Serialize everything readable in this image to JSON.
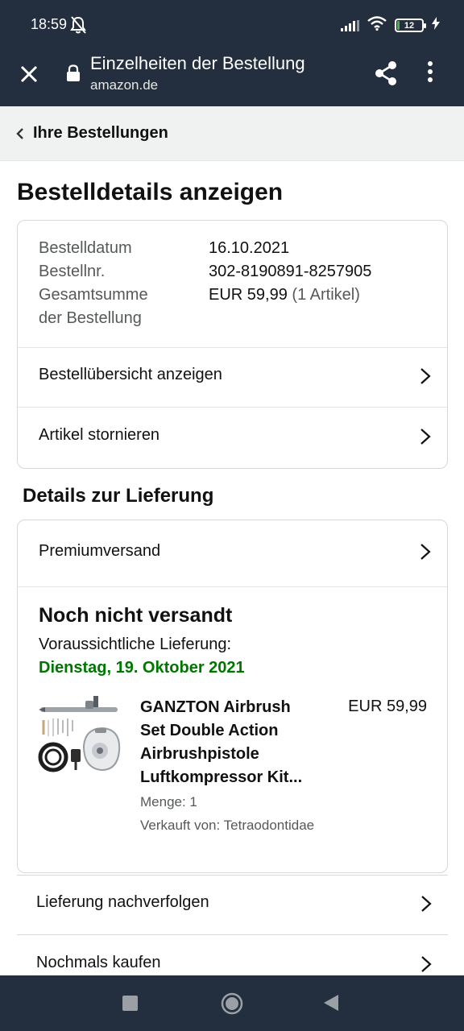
{
  "status_bar": {
    "time": "18:59",
    "battery": "12",
    "icons": [
      "mute-bell-icon",
      "signal-icon",
      "wifi-icon",
      "battery-icon",
      "charging-bolt-icon"
    ]
  },
  "browser": {
    "title": "Einzelheiten der Bestellung",
    "domain": "amazon.de",
    "icons": [
      "close-icon",
      "lock-icon",
      "share-icon",
      "more-vertical-icon"
    ]
  },
  "breadcrumb": {
    "label": "Ihre Bestellungen"
  },
  "page_title": "Bestelldetails anzeigen",
  "summary": {
    "date_label": "Bestelldatum",
    "date_value": "16.10.2021",
    "order_label": "Bestellnr.",
    "order_value": "302-8190891-8257905",
    "total_label_line1": "Gesamtsumme",
    "total_label_line2": "der Bestellung",
    "total_value": "EUR 59,99",
    "total_items": "(1 Artikel)"
  },
  "links": {
    "overview": "Bestellübersicht anzeigen",
    "cancel": "Artikel stornieren"
  },
  "delivery": {
    "section_title": "Details zur Lieferung",
    "shipping_method": "Premiumversand",
    "status": "Noch nicht versandt",
    "estimate_label": "Voraussichtliche Lieferung:",
    "estimate_date": "Dienstag, 19. Oktober 2021",
    "estimate_color": "#007600"
  },
  "product": {
    "name_line1": "GANZTON Airbrush",
    "name_line2": "Set Double Action",
    "name_line3": "Airbrushpistole",
    "name_line4": "Luftkompressor Kit...",
    "price": "EUR 59,99",
    "quantity": "Menge: 1",
    "seller": "Verkauft von: Tetraodontidae"
  },
  "actions": {
    "track": "Lieferung nachverfolgen",
    "buy_again": "Nochmals kaufen"
  },
  "nav": {
    "icons": [
      "recents-square-icon",
      "home-circle-icon",
      "back-triangle-icon"
    ]
  },
  "colors": {
    "header_bg": "#232f3e",
    "breadcrumb_bg": "#f0f2f2",
    "delivery_green": "#007600"
  }
}
